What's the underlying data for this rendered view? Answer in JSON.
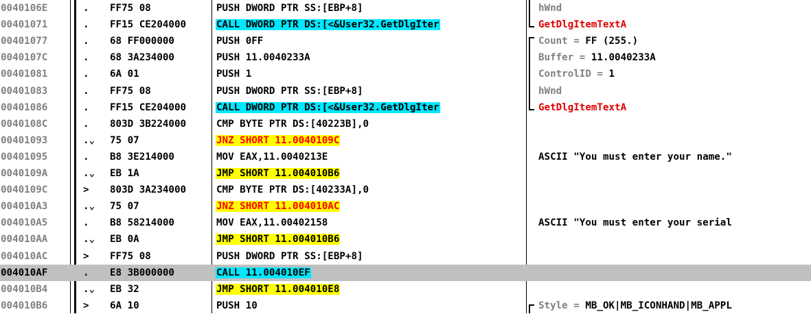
{
  "rows": [
    {
      "address": "0040106E",
      "flow": ".",
      "hex": "FF75 08",
      "instr": "PUSH DWORD PTR SS:[EBP+8]",
      "hl": "",
      "comment": "hWnd",
      "ctype": "gray"
    },
    {
      "address": "00401071",
      "flow": ".",
      "hex": "FF15 CE204000",
      "instr": "CALL DWORD PTR DS:[<&User32.GetDlgIter",
      "hl": "cyan",
      "comment": "GetDlgItemTextA",
      "ctype": "api"
    },
    {
      "address": "00401077",
      "flow": ".",
      "hex": "68 FF000000",
      "instr": "PUSH 0FF",
      "hl": "",
      "comment": "Count = ",
      "comment_val": "FF (255.)",
      "ctype": "gray"
    },
    {
      "address": "0040107C",
      "flow": ".",
      "hex": "68 3A234000",
      "instr": "PUSH 11.0040233A",
      "hl": "",
      "comment": "Buffer = ",
      "comment_val": "11.0040233A",
      "ctype": "gray"
    },
    {
      "address": "00401081",
      "flow": ".",
      "hex": "6A 01",
      "instr": "PUSH 1",
      "hl": "",
      "comment": "ControlID = ",
      "comment_val": "1",
      "ctype": "gray"
    },
    {
      "address": "00401083",
      "flow": ".",
      "hex": "FF75 08",
      "instr": "PUSH DWORD PTR SS:[EBP+8]",
      "hl": "",
      "comment": "hWnd",
      "ctype": "gray"
    },
    {
      "address": "00401086",
      "flow": ".",
      "hex": "FF15 CE204000",
      "instr": "CALL DWORD PTR DS:[<&User32.GetDlgIter",
      "hl": "cyan",
      "comment": "GetDlgItemTextA",
      "ctype": "api"
    },
    {
      "address": "0040108C",
      "flow": ".",
      "hex": "803D 3B224000",
      "instr": "CMP BYTE PTR DS:[40223B],0",
      "hl": "",
      "comment": "",
      "ctype": "plain"
    },
    {
      "address": "00401093",
      "flow": ".⌄",
      "hex": "75 07",
      "instr": "JNZ SHORT 11.0040109C",
      "hl": "jcc",
      "comment": "",
      "ctype": "plain"
    },
    {
      "address": "00401095",
      "flow": ".",
      "hex": "B8 3E214000",
      "instr": "MOV EAX,11.0040213E",
      "hl": "",
      "comment": "ASCII \"You must enter your name.\"",
      "ctype": "plain"
    },
    {
      "address": "0040109A",
      "flow": ".⌄",
      "hex": "EB 1A",
      "instr": "JMP SHORT 11.004010B6",
      "hl": "yellow",
      "comment": "",
      "ctype": "plain"
    },
    {
      "address": "0040109C",
      "flow": ">",
      "hex": "803D 3A234000",
      "instr": "CMP BYTE PTR DS:[40233A],0",
      "hl": "",
      "comment": "",
      "ctype": "plain"
    },
    {
      "address": "004010A3",
      "flow": ".⌄",
      "hex": "75 07",
      "instr": "JNZ SHORT 11.004010AC",
      "hl": "jcc",
      "comment": "",
      "ctype": "plain"
    },
    {
      "address": "004010A5",
      "flow": ".",
      "hex": "B8 58214000",
      "instr": "MOV EAX,11.00402158",
      "hl": "",
      "comment": "ASCII \"You must enter your serial",
      "ctype": "plain"
    },
    {
      "address": "004010AA",
      "flow": ".⌄",
      "hex": "EB 0A",
      "instr": "JMP SHORT 11.004010B6",
      "hl": "yellow",
      "comment": "",
      "ctype": "plain"
    },
    {
      "address": "004010AC",
      "flow": ">",
      "hex": "FF75 08",
      "instr": "PUSH DWORD PTR SS:[EBP+8]",
      "hl": "",
      "comment": "",
      "ctype": "plain"
    },
    {
      "address": "004010AF",
      "flow": ".",
      "hex": "E8 3B000000",
      "instr": "CALL 11.004010EF",
      "hl": "cyan",
      "comment": "",
      "ctype": "plain",
      "selected": true
    },
    {
      "address": "004010B4",
      "flow": ".⌄",
      "hex": "EB 32",
      "instr": "JMP SHORT 11.004010E8",
      "hl": "yellow",
      "comment": "",
      "ctype": "plain"
    },
    {
      "address": "004010B6",
      "flow": ">",
      "hex": "6A 10",
      "instr": "PUSH 10",
      "hl": "",
      "comment": "Style = ",
      "comment_val": "MB_OK|MB_ICONHAND|MB_APPL",
      "ctype": "gray"
    }
  ],
  "colors": {
    "call_highlight": "#00e8ff",
    "jump_highlight": "#ffff00",
    "conditional_jump_text": "#ff0000",
    "api_name_text": "#e00000",
    "address_text": "#808080",
    "selected_row": "#c0c0c0"
  }
}
